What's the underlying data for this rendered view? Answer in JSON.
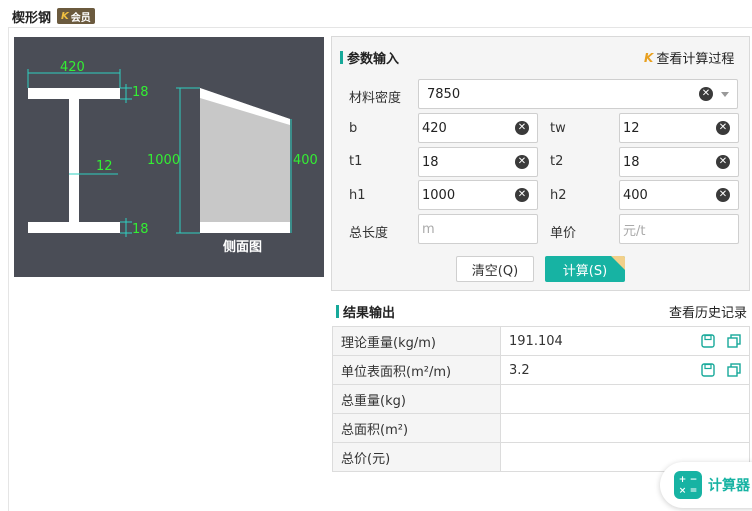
{
  "header": {
    "title": "楔形钢",
    "badge": "会员"
  },
  "diagram": {
    "dims": {
      "b": "420",
      "tf_top": "18",
      "tw": "12",
      "h1": "1000",
      "tf_bottom": "18",
      "h2": "400"
    },
    "side_label": "侧面图"
  },
  "params": {
    "section_title": "参数输入",
    "process_link": "查看计算过程",
    "density": {
      "label": "材料密度",
      "value": "7850"
    },
    "b": {
      "label": "b",
      "value": "420"
    },
    "tw": {
      "label": "tw",
      "value": "12"
    },
    "t1": {
      "label": "t1",
      "value": "18"
    },
    "t2": {
      "label": "t2",
      "value": "18"
    },
    "h1": {
      "label": "h1",
      "value": "1000"
    },
    "h2": {
      "label": "h2",
      "value": "400"
    },
    "length": {
      "label": "总长度",
      "placeholder": "m"
    },
    "price": {
      "label": "单价",
      "placeholder": "元/t"
    },
    "clear_btn": "清空(Q)",
    "calc_btn": "计算(S)"
  },
  "results": {
    "section_title": "结果输出",
    "history_link": "查看历史记录",
    "rows": [
      {
        "name": "理论重量(kg/m)",
        "value": "191.104"
      },
      {
        "name": "单位表面积(m²/m)",
        "value": "3.2"
      },
      {
        "name": "总重量(kg)",
        "value": ""
      },
      {
        "name": "总面积(m²)",
        "value": ""
      },
      {
        "name": "总价(元)",
        "value": ""
      }
    ]
  },
  "floating": {
    "label": "计算器"
  }
}
